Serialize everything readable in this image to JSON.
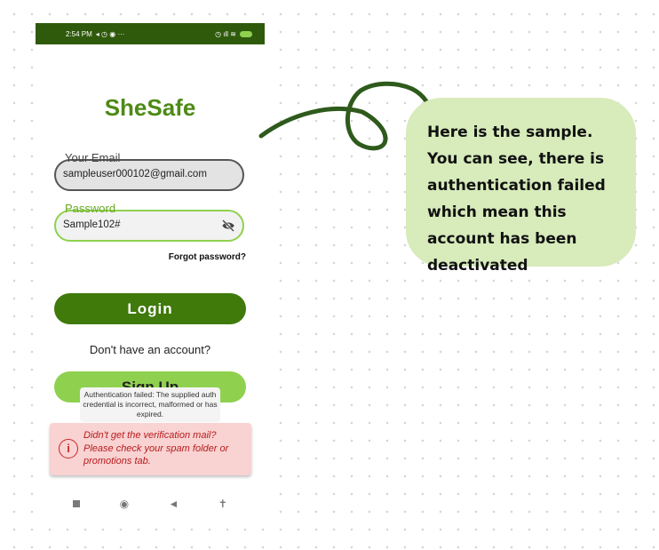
{
  "status_bar": {
    "time": "2:54 PM",
    "left_icons": "◂ ◷ ◉ ···",
    "right_icons": "◷ ıll ≋"
  },
  "app": {
    "title": "SheSafe",
    "email": {
      "label": "Your Email",
      "value": "sampleuser000102@gmail.com"
    },
    "password": {
      "label": "Password",
      "value": "Sample102#"
    },
    "forgot_password": "Forgot password?",
    "login_button": "Login",
    "no_account_text": "Don't have an account?",
    "signup_button": "Sign Up",
    "toast": "Authentication failed: The supplied auth credential is incorrect, malformed or has expired.",
    "alert": {
      "icon": "i",
      "text": "Didn't get the verification mail? Please check your spam folder or promotions tab."
    }
  },
  "nav_bar": {
    "recents": "■",
    "home": "◉",
    "back": "◄",
    "accessibility": "✝"
  },
  "annotation": {
    "text": "Here is the sample. You can see, there is authentication failed which mean this account has been deactivated"
  },
  "colors": {
    "brand_dark": "#3f7a0b",
    "brand_light": "#8fd14f",
    "title_green": "#4e8a16",
    "status_bar": "#2f5a0c",
    "alert_bg": "#f9d2d2",
    "bubble_bg": "#d7ebbb",
    "arrow": "#2e5a1c"
  }
}
